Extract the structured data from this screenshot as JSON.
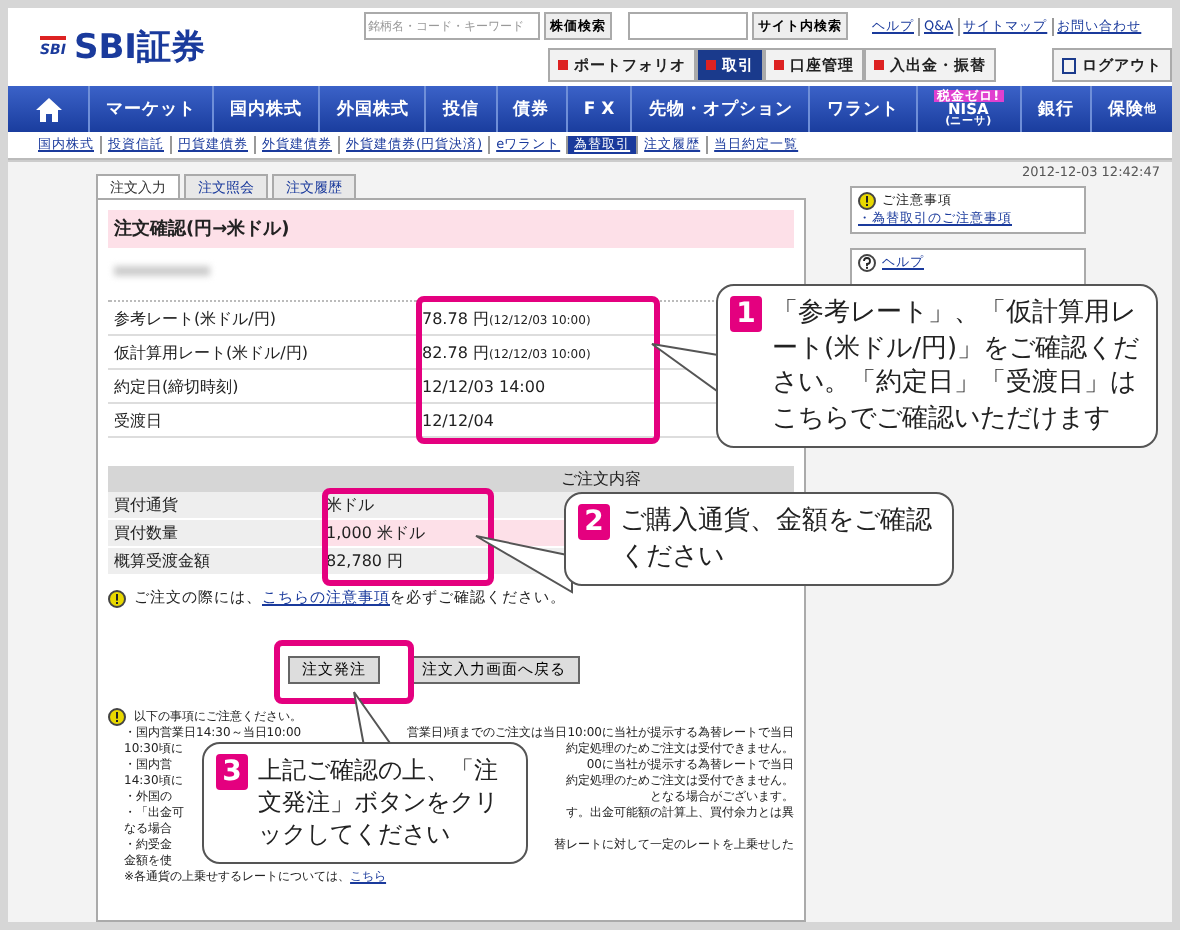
{
  "header": {
    "logo": "SBI証券",
    "logo_sub": "SBI",
    "search": {
      "placeholder": "銘柄名・コード・キーワード",
      "button": "株価検索"
    },
    "site_search": {
      "button": "サイト内検索"
    },
    "links": [
      "ヘルプ",
      "Q&A",
      "サイトマップ",
      "お問い合わせ"
    ],
    "menu": [
      {
        "label": "ポートフォリオ",
        "selected": false
      },
      {
        "label": "取引",
        "selected": true
      },
      {
        "label": "口座管理",
        "selected": false
      },
      {
        "label": "入出金・振替",
        "selected": false
      }
    ],
    "logout": "ログアウト"
  },
  "nav": [
    {
      "kind": "home"
    },
    {
      "kind": "text",
      "label": "マーケット"
    },
    {
      "kind": "text",
      "label": "国内株式"
    },
    {
      "kind": "text",
      "label": "外国株式"
    },
    {
      "kind": "text",
      "label": "投信"
    },
    {
      "kind": "text",
      "label": "債券"
    },
    {
      "kind": "text",
      "label": "F X"
    },
    {
      "kind": "text",
      "label": "先物・オプション"
    },
    {
      "kind": "text",
      "label": "ワラント"
    },
    {
      "kind": "nisa",
      "label": "NISA",
      "badge": "税金ゼロ!",
      "sub": "(ニーサ)"
    },
    {
      "kind": "text",
      "label": "銀行"
    },
    {
      "kind": "text",
      "label": "保険",
      "sub": "他"
    }
  ],
  "subnav": [
    {
      "label": "国内株式",
      "selected": false
    },
    {
      "label": "投資信託",
      "selected": false
    },
    {
      "label": "円貨建債券",
      "selected": false
    },
    {
      "label": "外貨建債券",
      "selected": false
    },
    {
      "label": "外貨建債券(円貨決済)",
      "selected": false
    },
    {
      "label": "eワラント",
      "selected": false
    },
    {
      "label": "為替取引",
      "selected": true
    },
    {
      "label": "注文履歴",
      "selected": false
    },
    {
      "label": "当日約定一覧",
      "selected": false
    }
  ],
  "timestamp": "2012-12-03 12:42:47",
  "tabs": [
    {
      "label": "注文入力",
      "selected": true
    },
    {
      "label": "注文照会",
      "selected": false
    },
    {
      "label": "注文履歴",
      "selected": false
    }
  ],
  "title": "注文確認(円→米ドル)",
  "rates": [
    {
      "label": "参考レート(米ドル/円)",
      "value": "78.78 円",
      "note": "(12/12/03 10:00)"
    },
    {
      "label": "仮計算用レート(米ドル/円)",
      "value": "82.78 円",
      "note": "(12/12/03 10:00)"
    },
    {
      "label": "約定日(締切時刻)",
      "value": "12/12/03 14:00"
    },
    {
      "label": "受渡日",
      "value": "12/12/04"
    }
  ],
  "order": {
    "heading": "ご注文内容",
    "rows": [
      {
        "label": "買付通貨",
        "value": "米ドル",
        "highlight": false
      },
      {
        "label": "買付数量",
        "value": "1,000 米ドル",
        "highlight": true
      },
      {
        "label": "概算受渡金額",
        "value": "82,780 円",
        "highlight": false
      }
    ]
  },
  "notice": {
    "before": "ご注文の際には、",
    "link": "こちらの注意事項",
    "after": "を必ずご確認ください。"
  },
  "buttons": [
    "注文発注",
    "注文入力画面へ戻る"
  ],
  "notes": {
    "heading": "以下の事項にご注意ください。",
    "lines": [
      {
        "left": "・国内営業日14:30～当日10:00",
        "right": "営業日)頃までのご注文は当日10:00に当社が提示する為替レートで当日"
      },
      {
        "left": "10:30頃に",
        "right": "約定処理のためご注文は受付できません。"
      },
      {
        "left": "・国内営",
        "right": "00に当社が提示する為替レートで当日"
      },
      {
        "left": "14:30頃に",
        "right": "約定処理のためご注文は受付できません。"
      },
      {
        "left": "・外国の",
        "right": "となる場合がございます。"
      },
      {
        "left": "・「出金可",
        "right": "す。出金可能額の計算上、買付余力とは異"
      },
      {
        "left": "なる場合"
      },
      {
        "left": "・約受金",
        "right": "替レートに対して一定のレートを上乗せした"
      },
      {
        "left": "金額を使"
      }
    ],
    "footer_before": "※各通貨の上乗せするレートについては、",
    "footer_link": "こちら"
  },
  "sidebar": [
    {
      "kind": "warning",
      "title": "ご注意事項",
      "link": "・為替取引のご注意事項"
    },
    {
      "kind": "help",
      "title": "ヘルプ"
    }
  ],
  "callouts": [
    {
      "number": "1",
      "text": "「参考レート」、「仮計算用レート(米ドル/円)」をご確認ください。「約定日」「受渡日」はこちらでご確認いただけます"
    },
    {
      "number": "2",
      "text": "ご購入通貨、金額をご確認ください"
    },
    {
      "number": "3",
      "text": "上記ご確認の上、「注文発注」ボタンをクリックしてください"
    }
  ]
}
